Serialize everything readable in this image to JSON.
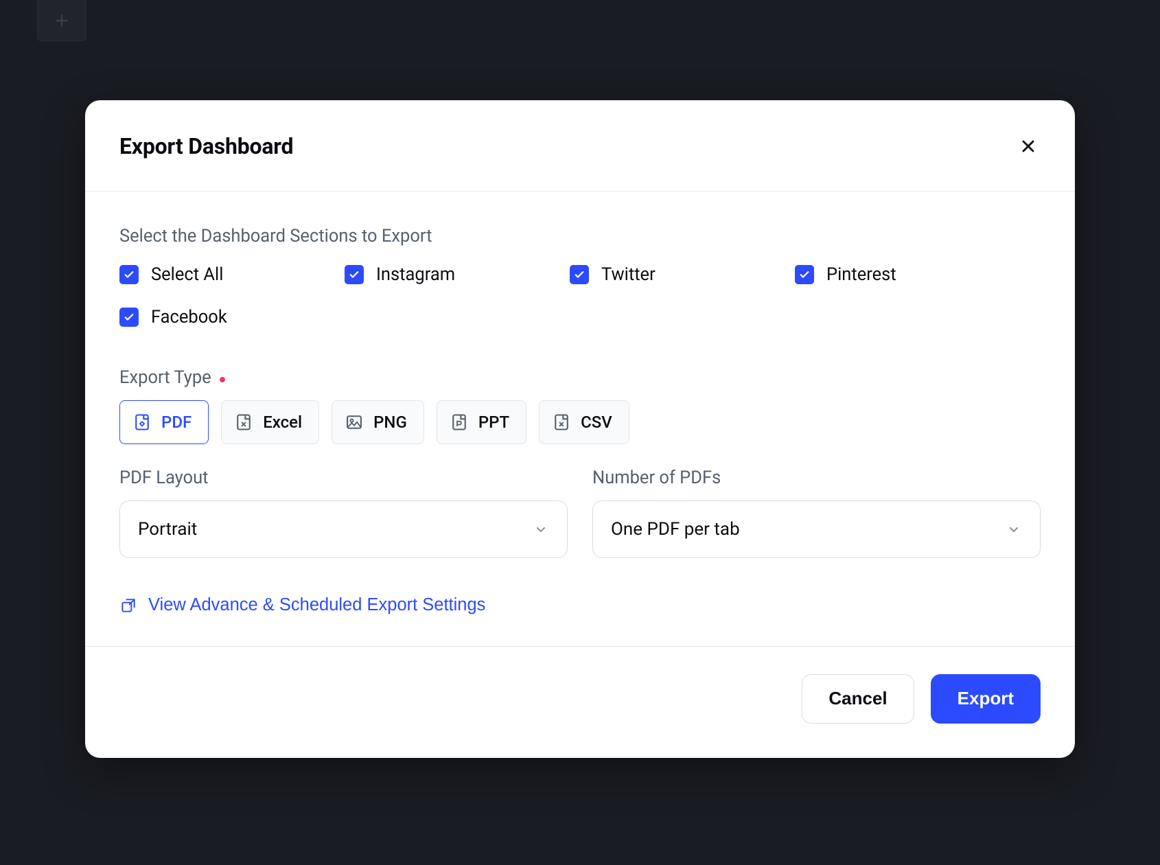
{
  "modal": {
    "title": "Export Dashboard",
    "sections_label": "Select the Dashboard Sections to Export",
    "checkboxes": {
      "select_all": {
        "label": "Select All",
        "checked": true
      },
      "instagram": {
        "label": "Instagram",
        "checked": true
      },
      "twitter": {
        "label": "Twitter",
        "checked": true
      },
      "pinterest": {
        "label": "Pinterest",
        "checked": true
      },
      "facebook": {
        "label": "Facebook",
        "checked": true
      }
    },
    "export_type": {
      "label": "Export Type",
      "required": true,
      "options": {
        "pdf": {
          "label": "PDF",
          "selected": true
        },
        "excel": {
          "label": "Excel",
          "selected": false
        },
        "png": {
          "label": "PNG",
          "selected": false
        },
        "ppt": {
          "label": "PPT",
          "selected": false
        },
        "csv": {
          "label": "CSV",
          "selected": false
        }
      }
    },
    "pdf_layout": {
      "label": "PDF Layout",
      "value": "Portrait"
    },
    "num_pdfs": {
      "label": "Number of PDFs",
      "value": "One PDF per tab"
    },
    "advanced_link": "View Advance & Scheduled Export Settings",
    "footer": {
      "cancel": "Cancel",
      "export": "Export"
    }
  },
  "colors": {
    "accent": "#2c4bff",
    "background": "#1a1c23"
  }
}
